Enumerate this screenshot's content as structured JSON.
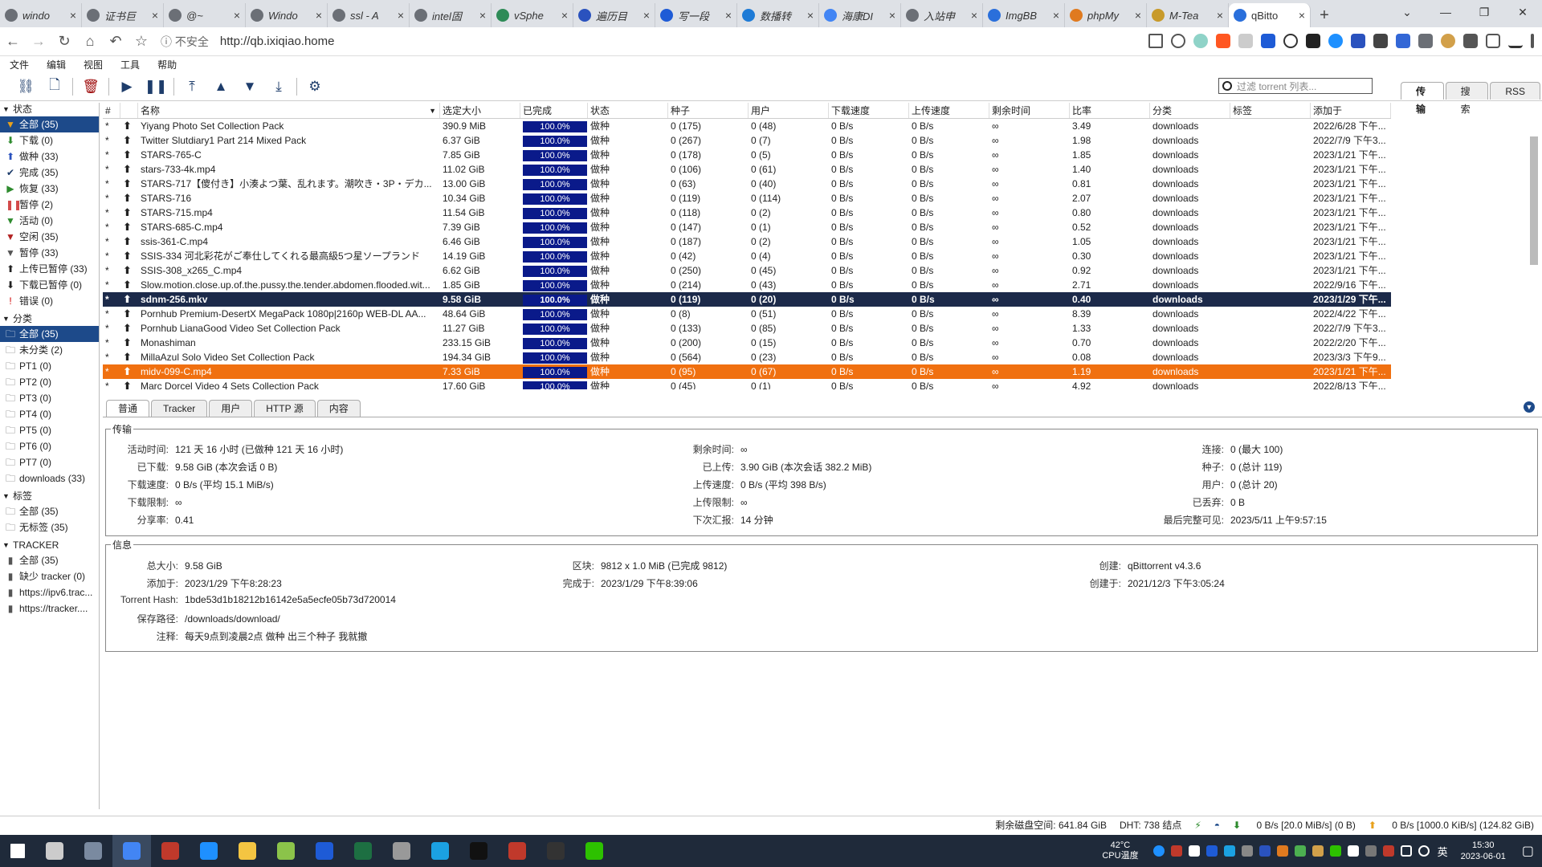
{
  "browser": {
    "tabs": [
      {
        "title": "windo",
        "color": "#6b6f76"
      },
      {
        "title": "证书巨",
        "color": "#6b6f76"
      },
      {
        "title": "@~",
        "color": "#6b6f76"
      },
      {
        "title": "Windo",
        "color": "#6b6f76"
      },
      {
        "title": "ssl - A",
        "color": "#6b6f76"
      },
      {
        "title": "intel固",
        "color": "#6b6f76"
      },
      {
        "title": "vSphe",
        "color": "#2e8b57"
      },
      {
        "title": "遍历目",
        "color": "#2a52be"
      },
      {
        "title": "写一段",
        "color": "#1e5bd6"
      },
      {
        "title": "数播转",
        "color": "#1e7bd6"
      },
      {
        "title": "海康DI",
        "color": "#4285f4"
      },
      {
        "title": "入站申",
        "color": "#6b6f76"
      },
      {
        "title": "ImgBB",
        "color": "#2a6fdb"
      },
      {
        "title": "phpMy",
        "color": "#e07a1f"
      },
      {
        "title": "M-Tea",
        "color": "#c89a2a"
      },
      {
        "title": "qBitto",
        "color": "#2a6fdb",
        "active": true
      }
    ],
    "close_glyph": "×",
    "new_tab_glyph": "+",
    "security_label": "不安全",
    "url": "http://qb.ixiqiao.home",
    "window_controls": [
      "⌄",
      "—",
      "❐",
      "✕"
    ]
  },
  "menu": [
    "文件",
    "编辑",
    "视图",
    "工具",
    "帮助"
  ],
  "filter": {
    "placeholder": "过滤 torrent 列表..."
  },
  "view_tabs": [
    {
      "label": "传输",
      "active": true
    },
    {
      "label": "搜索"
    },
    {
      "label": "RSS"
    }
  ],
  "sidebar": {
    "status_title": "状态",
    "status": [
      {
        "label": "全部 (35)",
        "icon": "funnel-icon",
        "glyph": "▼",
        "color": "#e8a11c",
        "selected": true
      },
      {
        "label": "下载 (0)",
        "icon": "download-arrow-icon",
        "glyph": "⬇",
        "color": "#2e8b2e"
      },
      {
        "label": "做种 (33)",
        "icon": "upload-arrow-icon",
        "glyph": "⬆",
        "color": "#2a52be"
      },
      {
        "label": "完成 (35)",
        "icon": "checkmark-icon",
        "glyph": "✔",
        "color": "#1e3d6b"
      },
      {
        "label": "恢复 (33)",
        "icon": "play-icon",
        "glyph": "▶",
        "color": "#2e8b2e"
      },
      {
        "label": "暂停 (2)",
        "icon": "pause-icon",
        "glyph": "❚❚",
        "color": "#d24a4a"
      },
      {
        "label": "活动 (0)",
        "icon": "filter-icon",
        "glyph": "▼",
        "color": "#2e8b2e"
      },
      {
        "label": "空闲 (35)",
        "icon": "filter-icon",
        "glyph": "▼",
        "color": "#b22222"
      },
      {
        "label": "暂停 (33)",
        "icon": "filter-icon",
        "glyph": "▼",
        "color": "#555555"
      },
      {
        "label": "上传已暂停 (33)",
        "icon": "upload-arrow-icon",
        "glyph": "⬆",
        "color": "#222222"
      },
      {
        "label": "下载已暂停 (0)",
        "icon": "download-arrow-icon",
        "glyph": "⬇",
        "color": "#222222"
      },
      {
        "label": "错误 (0)",
        "icon": "error-icon",
        "glyph": "!",
        "color": "#d00000"
      }
    ],
    "category_title": "分类",
    "categories": [
      {
        "label": "全部 (35)",
        "selected": true
      },
      {
        "label": "未分类 (2)"
      },
      {
        "label": "PT1 (0)"
      },
      {
        "label": "PT2 (0)"
      },
      {
        "label": "PT3 (0)"
      },
      {
        "label": "PT4 (0)"
      },
      {
        "label": "PT5 (0)"
      },
      {
        "label": "PT6 (0)"
      },
      {
        "label": "PT7 (0)"
      },
      {
        "label": "downloads (33)"
      }
    ],
    "tags_title": "标签",
    "tags": [
      {
        "label": "全部 (35)"
      },
      {
        "label": "无标签 (35)"
      }
    ],
    "tracker_title": "TRACKER",
    "trackers": [
      {
        "label": "全部 (35)"
      },
      {
        "label": "缺少 tracker (0)"
      },
      {
        "label": "https://ipv6.trac..."
      },
      {
        "label": "https://tracker...."
      }
    ]
  },
  "table": {
    "headers": [
      "#",
      "",
      "名称",
      "选定大小",
      "已完成",
      "状态",
      "种子",
      "用户",
      "下载速度",
      "上传速度",
      "剩余时间",
      "比率",
      "分类",
      "标签",
      "添加于"
    ],
    "sort_indicator": "▼",
    "rows": [
      {
        "name": "Yiyang Photo Set Collection Pack",
        "size": "390.9 MiB",
        "done": "100.0%",
        "status": "做种",
        "seeds": "0 (175)",
        "peers": "0 (48)",
        "dl": "0 B/s",
        "ul": "0 B/s",
        "eta": "∞",
        "ratio": "3.49",
        "cat": "downloads",
        "tag": "",
        "added": "2022/6/28 下午..."
      },
      {
        "name": "Twitter Slutdiary1 Part 214 Mixed Pack",
        "size": "6.37 GiB",
        "done": "100.0%",
        "status": "做种",
        "seeds": "0 (267)",
        "peers": "0 (7)",
        "dl": "0 B/s",
        "ul": "0 B/s",
        "eta": "∞",
        "ratio": "1.98",
        "cat": "downloads",
        "tag": "",
        "added": "2022/7/9 下午3..."
      },
      {
        "name": "STARS-765-C",
        "size": "7.85 GiB",
        "done": "100.0%",
        "status": "做种",
        "seeds": "0 (178)",
        "peers": "0 (5)",
        "dl": "0 B/s",
        "ul": "0 B/s",
        "eta": "∞",
        "ratio": "1.85",
        "cat": "downloads",
        "tag": "",
        "added": "2023/1/21 下午..."
      },
      {
        "name": "stars-733-4k.mp4",
        "size": "11.02 GiB",
        "done": "100.0%",
        "status": "做种",
        "seeds": "0 (106)",
        "peers": "0 (61)",
        "dl": "0 B/s",
        "ul": "0 B/s",
        "eta": "∞",
        "ratio": "1.40",
        "cat": "downloads",
        "tag": "",
        "added": "2023/1/21 下午..."
      },
      {
        "name": "STARS-717【傻付き】小湊よつ葉、乱れます。潮吹き・3P・デカ...",
        "size": "13.00 GiB",
        "done": "100.0%",
        "status": "做种",
        "seeds": "0 (63)",
        "peers": "0 (40)",
        "dl": "0 B/s",
        "ul": "0 B/s",
        "eta": "∞",
        "ratio": "0.81",
        "cat": "downloads",
        "tag": "",
        "added": "2023/1/21 下午..."
      },
      {
        "name": "STARS-716",
        "size": "10.34 GiB",
        "done": "100.0%",
        "status": "做种",
        "seeds": "0 (119)",
        "peers": "0 (114)",
        "dl": "0 B/s",
        "ul": "0 B/s",
        "eta": "∞",
        "ratio": "2.07",
        "cat": "downloads",
        "tag": "",
        "added": "2023/1/21 下午..."
      },
      {
        "name": "STARS-715.mp4",
        "size": "11.54 GiB",
        "done": "100.0%",
        "status": "做种",
        "seeds": "0 (118)",
        "peers": "0 (2)",
        "dl": "0 B/s",
        "ul": "0 B/s",
        "eta": "∞",
        "ratio": "0.80",
        "cat": "downloads",
        "tag": "",
        "added": "2023/1/21 下午..."
      },
      {
        "name": "STARS-685-C.mp4",
        "size": "7.39 GiB",
        "done": "100.0%",
        "status": "做种",
        "seeds": "0 (147)",
        "peers": "0 (1)",
        "dl": "0 B/s",
        "ul": "0 B/s",
        "eta": "∞",
        "ratio": "0.52",
        "cat": "downloads",
        "tag": "",
        "added": "2023/1/21 下午..."
      },
      {
        "name": "ssis-361-C.mp4",
        "size": "6.46 GiB",
        "done": "100.0%",
        "status": "做种",
        "seeds": "0 (187)",
        "peers": "0 (2)",
        "dl": "0 B/s",
        "ul": "0 B/s",
        "eta": "∞",
        "ratio": "1.05",
        "cat": "downloads",
        "tag": "",
        "added": "2023/1/21 下午..."
      },
      {
        "name": "SSIS-334 河北彩花がご奉仕してくれる最高級5つ星ソープランド",
        "size": "14.19 GiB",
        "done": "100.0%",
        "status": "做种",
        "seeds": "0 (42)",
        "peers": "0 (4)",
        "dl": "0 B/s",
        "ul": "0 B/s",
        "eta": "∞",
        "ratio": "0.30",
        "cat": "downloads",
        "tag": "",
        "added": "2023/1/21 下午..."
      },
      {
        "name": "SSIS-308_x265_C.mp4",
        "size": "6.62 GiB",
        "done": "100.0%",
        "status": "做种",
        "seeds": "0 (250)",
        "peers": "0 (45)",
        "dl": "0 B/s",
        "ul": "0 B/s",
        "eta": "∞",
        "ratio": "0.92",
        "cat": "downloads",
        "tag": "",
        "added": "2023/1/21 下午..."
      },
      {
        "name": "Slow.motion.close.up.of.the.pussy.the.tender.abdomen.flooded.wit...",
        "size": "1.85 GiB",
        "done": "100.0%",
        "status": "做种",
        "seeds": "0 (214)",
        "peers": "0 (43)",
        "dl": "0 B/s",
        "ul": "0 B/s",
        "eta": "∞",
        "ratio": "2.71",
        "cat": "downloads",
        "tag": "",
        "added": "2022/9/16 下午..."
      },
      {
        "name": "sdnm-256.mkv",
        "size": "9.58 GiB",
        "done": "100.0%",
        "status": "做种",
        "seeds": "0 (119)",
        "peers": "0 (20)",
        "dl": "0 B/s",
        "ul": "0 B/s",
        "eta": "∞",
        "ratio": "0.40",
        "cat": "downloads",
        "tag": "",
        "added": "2023/1/29 下午...",
        "selected": true
      },
      {
        "name": "Pornhub Premium-DesertX MegaPack 1080p|2160p WEB-DL AA...",
        "size": "48.64 GiB",
        "done": "100.0%",
        "status": "做种",
        "seeds": "0 (8)",
        "peers": "0 (51)",
        "dl": "0 B/s",
        "ul": "0 B/s",
        "eta": "∞",
        "ratio": "8.39",
        "cat": "downloads",
        "tag": "",
        "added": "2022/4/22 下午..."
      },
      {
        "name": "Pornhub LianaGood Video Set Collection Pack",
        "size": "11.27 GiB",
        "done": "100.0%",
        "status": "做种",
        "seeds": "0 (133)",
        "peers": "0 (85)",
        "dl": "0 B/s",
        "ul": "0 B/s",
        "eta": "∞",
        "ratio": "1.33",
        "cat": "downloads",
        "tag": "",
        "added": "2022/7/9 下午3..."
      },
      {
        "name": "Monashiman",
        "size": "233.15 GiB",
        "done": "100.0%",
        "status": "做种",
        "seeds": "0 (200)",
        "peers": "0 (15)",
        "dl": "0 B/s",
        "ul": "0 B/s",
        "eta": "∞",
        "ratio": "0.70",
        "cat": "downloads",
        "tag": "",
        "added": "2022/2/20 下午..."
      },
      {
        "name": "MillaAzul Solo Video Set Collection Pack",
        "size": "194.34 GiB",
        "done": "100.0%",
        "status": "做种",
        "seeds": "0 (564)",
        "peers": "0 (23)",
        "dl": "0 B/s",
        "ul": "0 B/s",
        "eta": "∞",
        "ratio": "0.08",
        "cat": "downloads",
        "tag": "",
        "added": "2023/3/3 下午9..."
      },
      {
        "name": "midv-099-C.mp4",
        "size": "7.33 GiB",
        "done": "100.0%",
        "status": "做种",
        "seeds": "0 (95)",
        "peers": "0 (67)",
        "dl": "0 B/s",
        "ul": "0 B/s",
        "eta": "∞",
        "ratio": "1.19",
        "cat": "downloads",
        "tag": "",
        "added": "2023/1/21 下午...",
        "highlight": true
      },
      {
        "name": "Marc Dorcel Video 4 Sets Collection Pack",
        "size": "17.60 GiB",
        "done": "100.0%",
        "status": "做种",
        "seeds": "0 (45)",
        "peers": "0 (1)",
        "dl": "0 B/s",
        "ul": "0 B/s",
        "eta": "∞",
        "ratio": "4.92",
        "cat": "downloads",
        "tag": "",
        "added": "2022/8/13 下午..."
      }
    ]
  },
  "props": {
    "tabs": [
      {
        "label": "普通",
        "active": true
      },
      {
        "label": "Tracker"
      },
      {
        "label": "用户"
      },
      {
        "label": "HTTP 源"
      },
      {
        "label": "内容"
      }
    ],
    "transfer_title": "传输",
    "transfer": {
      "col1": [
        {
          "k": "活动时间:",
          "v": "121 天 16 小时 (已做种 121 天 16 小时)"
        },
        {
          "k": "已下载:",
          "v": "9.58 GiB (本次会话 0 B)"
        },
        {
          "k": "下载速度:",
          "v": "0 B/s (平均 15.1 MiB/s)"
        },
        {
          "k": "下载限制:",
          "v": "∞"
        },
        {
          "k": "分享率:",
          "v": "0.41"
        }
      ],
      "col2": [
        {
          "k": "剩余时间:",
          "v": "∞"
        },
        {
          "k": "已上传:",
          "v": "3.90 GiB (本次会话 382.2 MiB)"
        },
        {
          "k": "上传速度:",
          "v": "0 B/s (平均 398 B/s)"
        },
        {
          "k": "上传限制:",
          "v": "∞"
        },
        {
          "k": "下次汇报:",
          "v": "14 分钟"
        }
      ],
      "col3": [
        {
          "k": "连接:",
          "v": "0 (最大 100)"
        },
        {
          "k": "种子:",
          "v": "0 (总计 119)"
        },
        {
          "k": "用户:",
          "v": "0 (总计 20)"
        },
        {
          "k": "已丢弃:",
          "v": "0 B"
        },
        {
          "k": "最后完整可见:",
          "v": "2023/5/11 上午9:57:15"
        }
      ]
    },
    "info_title": "信息",
    "info": {
      "col1": [
        {
          "k": "总大小:",
          "v": "9.58 GiB"
        },
        {
          "k": "添加于:",
          "v": "2023/1/29 下午8:28:23"
        },
        {
          "k": "Torrent Hash:",
          "v": "1bde53d1b18212b16142e5a5ecfe05b73d720014"
        },
        {
          "k": "保存路径:",
          "v": "/downloads/download/"
        },
        {
          "k": "注释:",
          "v": "每天9点到凌晨2点 做种 出三个种子 我就撤"
        }
      ],
      "col2": [
        {
          "k": "区块:",
          "v": "9812 x 1.0 MiB (已完成 9812)"
        },
        {
          "k": "完成于:",
          "v": "2023/1/29 下午8:39:06"
        }
      ],
      "col3": [
        {
          "k": "创建:",
          "v": "qBittorrent v4.3.6"
        },
        {
          "k": "创建于:",
          "v": "2021/12/3 下午3:05:24"
        }
      ]
    }
  },
  "status": {
    "disk": "剩余磁盘空间: 641.84 GiB",
    "dht": "DHT: 738 结点",
    "download": "0 B/s [20.0 MiB/s] (0 B)",
    "upload": "0 B/s [1000.0 KiB/s] (124.82 GiB)",
    "download_glyph": "⬇",
    "upload_glyph": "⬆"
  },
  "taskbar": {
    "temp_value": "42°C",
    "temp_label": "CPU温度",
    "ime": "英",
    "time": "15:30",
    "date": "2023-06-01",
    "apps": [
      {
        "icon": "windows-start-icon",
        "color": "#ffffff"
      },
      {
        "icon": "task-view-icon",
        "color": "#cccccc"
      },
      {
        "icon": "app-icon",
        "color": "#7a8aa0"
      },
      {
        "icon": "chrome-icon",
        "color": "#4285f4",
        "active": true
      },
      {
        "icon": "app-icon",
        "color": "#c0392b"
      },
      {
        "icon": "app-icon",
        "color": "#1e90ff"
      },
      {
        "icon": "folder-icon",
        "color": "#f4c542"
      },
      {
        "icon": "notepad-icon",
        "color": "#8bc34a"
      },
      {
        "icon": "app-icon",
        "color": "#1e5bd6"
      },
      {
        "icon": "excel-icon",
        "color": "#1d6f42"
      },
      {
        "icon": "app-icon",
        "color": "#999999"
      },
      {
        "icon": "edge-icon",
        "color": "#1ba1e2"
      },
      {
        "icon": "terminal-icon",
        "color": "#111111"
      },
      {
        "icon": "app-icon",
        "color": "#c0392b"
      },
      {
        "icon": "app-icon",
        "color": "#333333"
      },
      {
        "icon": "wechat-icon",
        "color": "#2dc100"
      }
    ]
  }
}
